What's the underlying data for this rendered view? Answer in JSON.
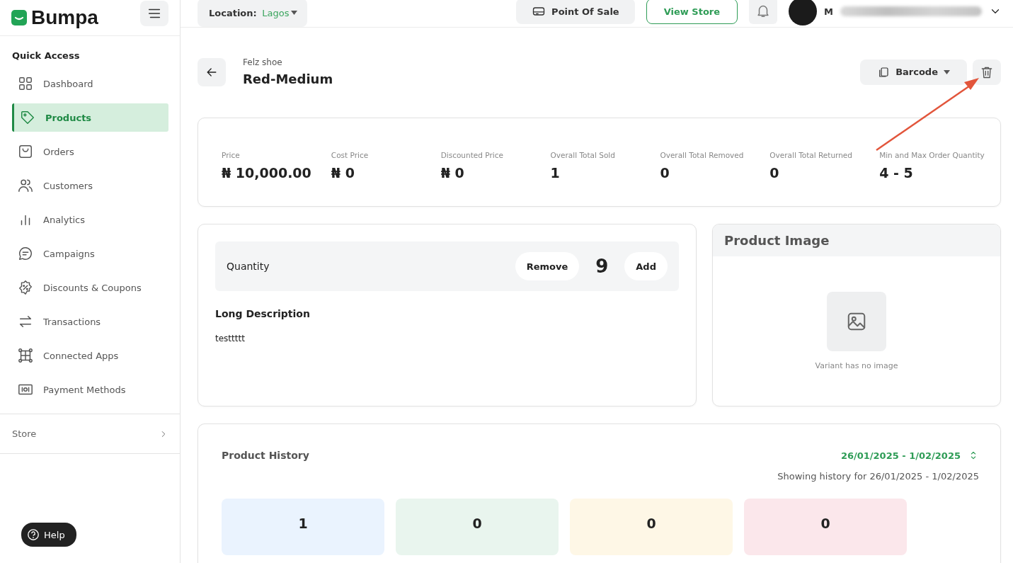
{
  "brand": {
    "name": "Bumpa"
  },
  "topbar": {
    "location_label": "Location:",
    "location_value": "Lagos",
    "point_of_sale": "Point Of Sale",
    "view_store": "View Store",
    "user_name": "M"
  },
  "sidebar": {
    "section": "Quick Access",
    "items": [
      {
        "label": "Dashboard",
        "selected": false
      },
      {
        "label": "Products",
        "selected": true
      },
      {
        "label": "Orders",
        "selected": false
      },
      {
        "label": "Customers",
        "selected": false
      },
      {
        "label": "Analytics",
        "selected": false
      },
      {
        "label": "Campaigns",
        "selected": false
      },
      {
        "label": "Discounts & Coupons",
        "selected": false
      },
      {
        "label": "Transactions",
        "selected": false
      },
      {
        "label": "Connected Apps",
        "selected": false
      },
      {
        "label": "Payment Methods",
        "selected": false
      }
    ],
    "store": "Store"
  },
  "help": "Help",
  "header": {
    "parent": "Felz shoe",
    "title": "Red-Medium",
    "barcode": "Barcode"
  },
  "stats": [
    {
      "label": "Price",
      "value": "₦ 10,000.00"
    },
    {
      "label": "Cost Price",
      "value": "₦ 0"
    },
    {
      "label": "Discounted Price",
      "value": "₦ 0"
    },
    {
      "label": "Overall Total Sold",
      "value": "1"
    },
    {
      "label": "Overall Total Removed",
      "value": "0"
    },
    {
      "label": "Overall Total Returned",
      "value": "0"
    },
    {
      "label": "Min and Max Order Quantity",
      "value": "4 - 5"
    }
  ],
  "quantity": {
    "label": "Quantity",
    "remove": "Remove",
    "value": "9",
    "add": "Add"
  },
  "description": {
    "title": "Long Description",
    "text": "testtttt"
  },
  "image_panel": {
    "title": "Product Image",
    "empty_text": "Variant has no image"
  },
  "history": {
    "title": "Product History",
    "date_range": "26/01/2025 - 1/02/2025",
    "caption": "Showing history for 26/01/2025 - 1/02/2025",
    "cards": [
      {
        "value": "1",
        "color": "#eaf3fe"
      },
      {
        "value": "0",
        "color": "#e9f5ee"
      },
      {
        "value": "0",
        "color": "#fef7e6"
      },
      {
        "value": "0",
        "color": "#fbe7eb"
      }
    ]
  }
}
